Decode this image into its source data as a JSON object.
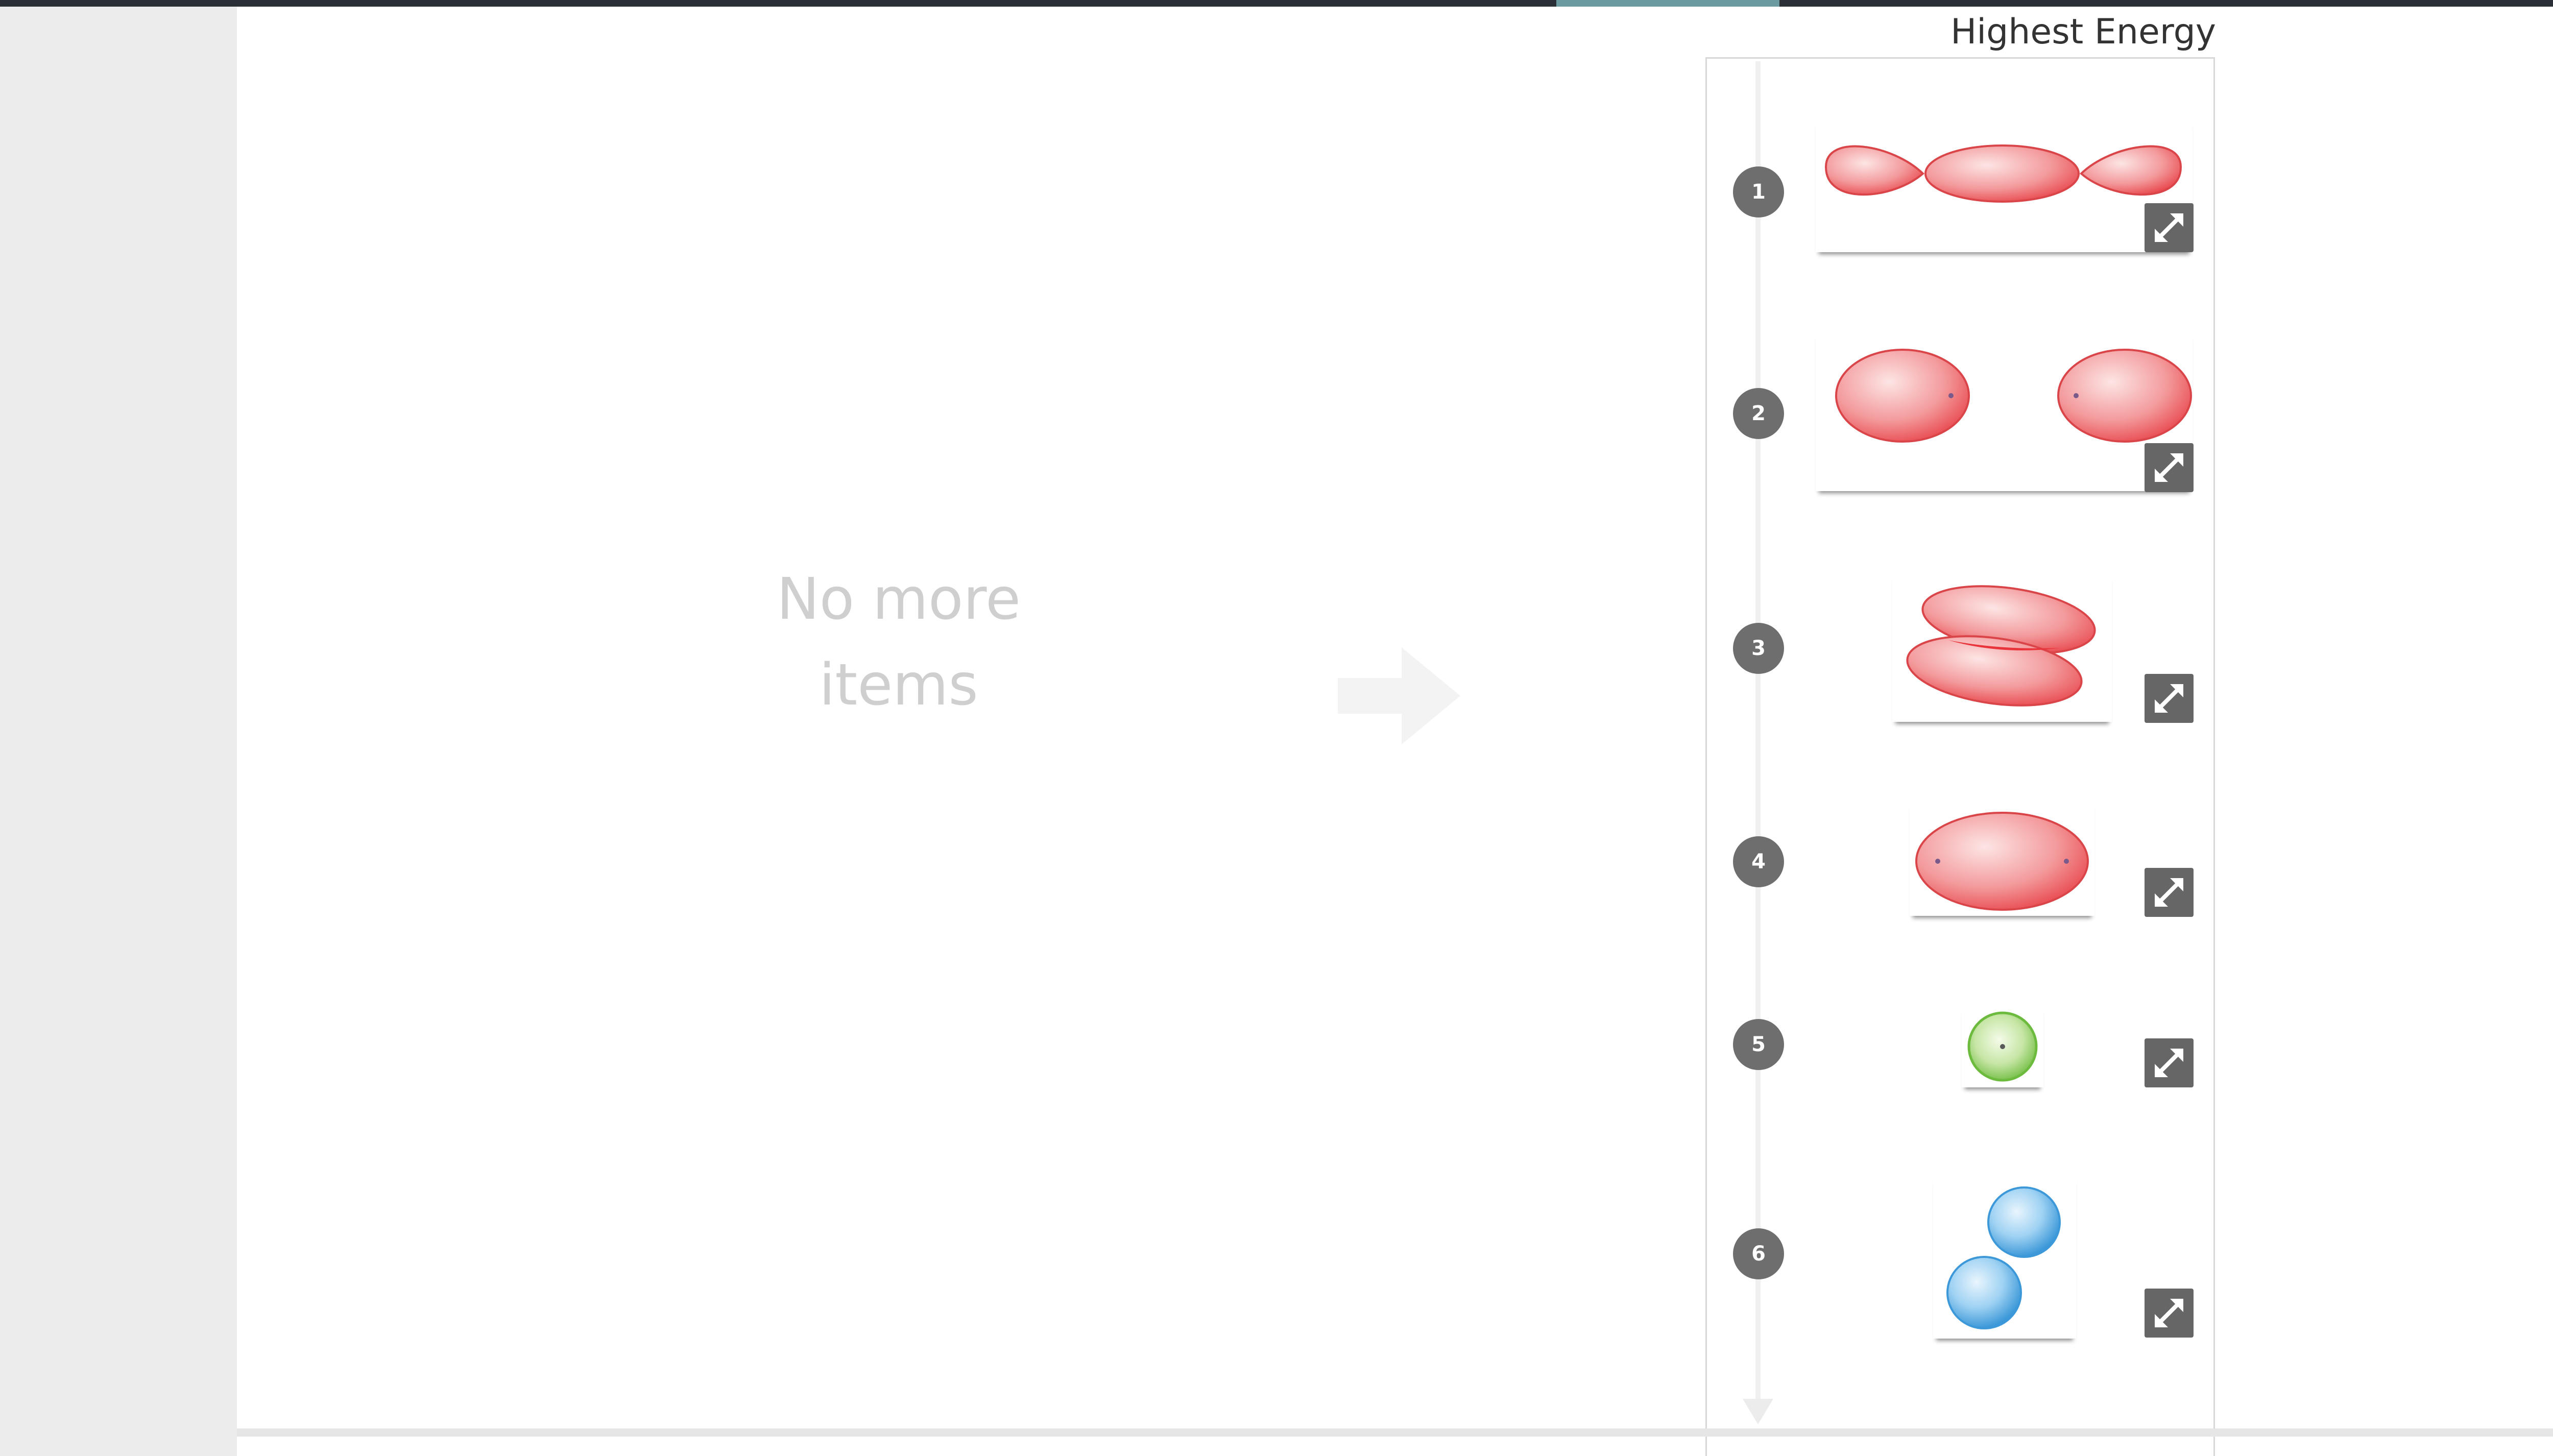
{
  "panel": {
    "title": "Highest Energy"
  },
  "source": {
    "empty_line_1": "No more",
    "empty_line_2": "items"
  },
  "items": [
    {
      "rank": "1",
      "orbital": "sigma-star-p-antibonding",
      "color": "#e8494e"
    },
    {
      "rank": "2",
      "orbital": "sigma-star-s-antibonding",
      "color": "#e8494e"
    },
    {
      "rank": "3",
      "orbital": "pi-bonding",
      "color": "#e8494e"
    },
    {
      "rank": "4",
      "orbital": "sigma-bonding",
      "color": "#e8494e"
    },
    {
      "rank": "5",
      "orbital": "s-atomic",
      "color": "#7dc24b"
    },
    {
      "rank": "6",
      "orbital": "p-atomic",
      "color": "#4aa3df"
    }
  ],
  "icons": {
    "expand": "expand-icon",
    "arrow": "arrow-right-icon"
  }
}
